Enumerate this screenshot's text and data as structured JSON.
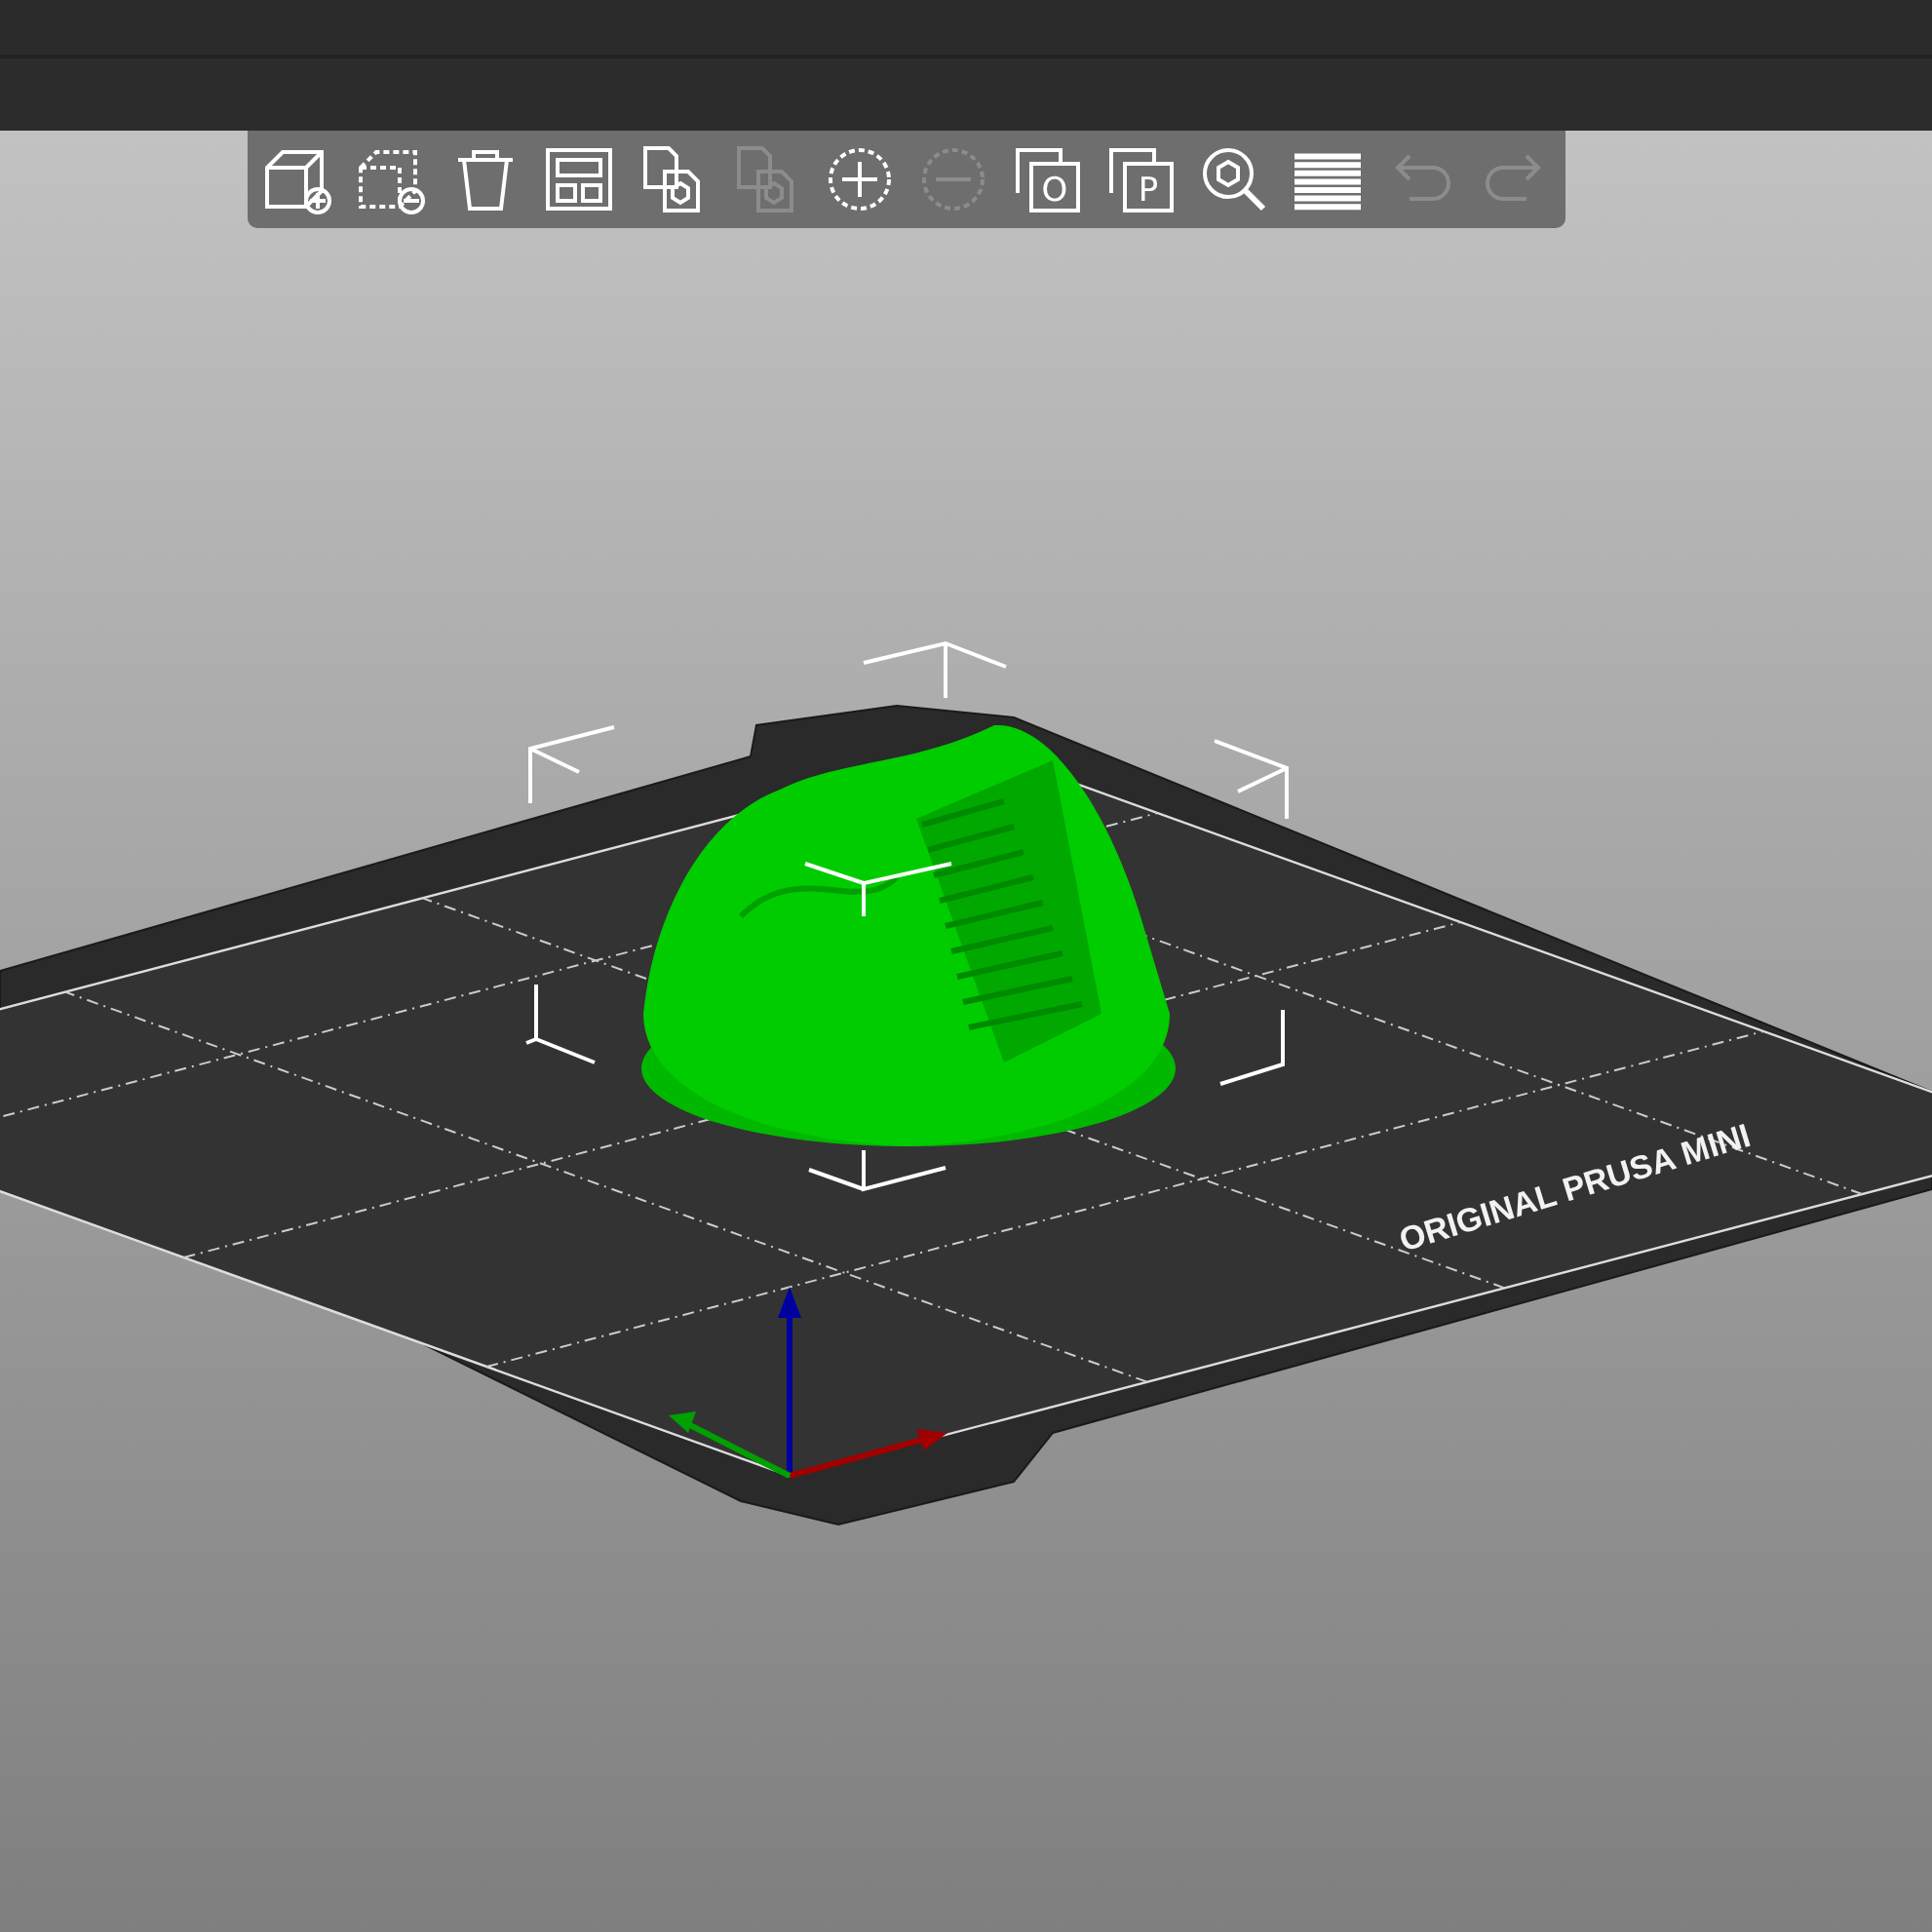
{
  "toolbar": {
    "buttons": [
      {
        "kind": "add",
        "disabled": false
      },
      {
        "kind": "delete",
        "disabled": false
      },
      {
        "kind": "delete-all",
        "disabled": false
      },
      {
        "kind": "arrange",
        "disabled": false
      },
      {
        "kind": "copy",
        "disabled": false
      },
      {
        "kind": "paste",
        "disabled": true
      },
      {
        "kind": "add-instance",
        "disabled": false
      },
      {
        "kind": "remove-instance",
        "disabled": true
      },
      {
        "kind": "split-objects",
        "disabled": false,
        "glyph": "O"
      },
      {
        "kind": "split-parts",
        "disabled": false,
        "glyph": "P"
      },
      {
        "kind": "search",
        "disabled": false
      },
      {
        "kind": "layers",
        "disabled": false
      },
      {
        "kind": "undo",
        "disabled": true
      },
      {
        "kind": "redo",
        "disabled": true
      }
    ]
  },
  "bed": {
    "label": "ORIGINAL PRUSA MINI"
  }
}
